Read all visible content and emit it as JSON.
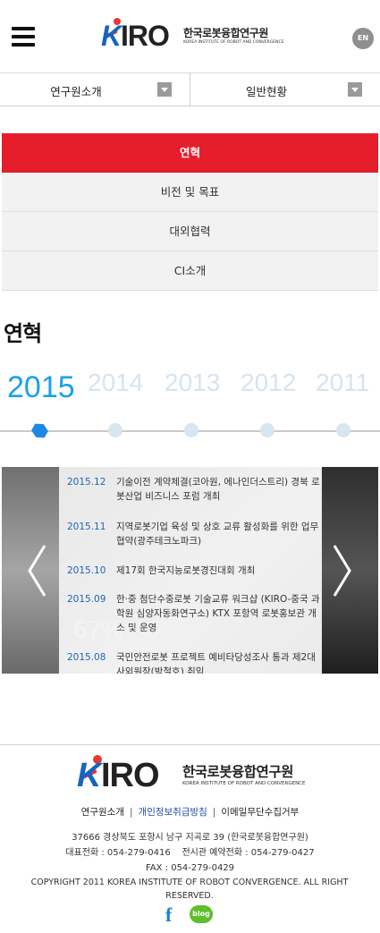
{
  "header": {
    "logo_mark": "KIRO",
    "logo_ko": "한국로봇융합연구원",
    "logo_en": "KOREA INSTITUTE OF ROBOT AND CONVERGENCE",
    "lang_button": "EN"
  },
  "nav_selects": [
    {
      "label": "연구원소개"
    },
    {
      "label": "일반현황"
    }
  ],
  "submenu": [
    {
      "label": "연혁",
      "active": true
    },
    {
      "label": "비전 및 목표",
      "active": false
    },
    {
      "label": "대외협력",
      "active": false
    },
    {
      "label": "CI소개",
      "active": false
    }
  ],
  "page_title": "연혁",
  "years": [
    "2015",
    "2014",
    "2013",
    "2012",
    "2011"
  ],
  "slider": {
    "bg_text": "67%",
    "events": [
      {
        "date": "2015.12",
        "text": "기술이전 계약체결(코아원, 에나인더스트리) 경북 로봇산업 비즈니스 포럼 개최"
      },
      {
        "date": "2015.11",
        "text": "지역로봇기업 육성 및 상호 교류 활성화를 위한 업무협약(광주테크노파크)"
      },
      {
        "date": "2015.10",
        "text": "제17회 한국지능로봇경진대회 개최"
      },
      {
        "date": "2015.09",
        "text": "한·중 첨단수중로봇 기술교류 워크샵 (KIRO-중국 과학원 심양자동화연구소) KTX 포항역 로봇홍보관 개소 및 운영"
      },
      {
        "date": "2015.08",
        "text": "국민안전로봇 프로젝트 예비타당성조사 통과 제2대 사외원장(박철호) 취임"
      }
    ]
  },
  "footer": {
    "logo_mark": "KIRO",
    "logo_ko": "한국로봇융합연구원",
    "logo_en": "KOREA INSTITUTE OF ROBOT AND CONVERGENCE",
    "links": [
      "연구원소개",
      "개인정보취급방침",
      "이메일무단수집거부"
    ],
    "address": "37666 경상북도 포항시 남구 지곡로 39 (한국로봇융합연구원)",
    "phones": "대표전화 : 054-279-0416    전시관 예약전화 : 054-279-0427",
    "fax": "FAX : 054-279-0429",
    "copyright": "COPYRIGHT 2011 KOREA INSTITUTE OF ROBOT CONVERGENCE. ALL RIGHT RESERVED.",
    "facebook": "f",
    "blog": "blog"
  },
  "colors": {
    "accent_red": "#e61e2b",
    "accent_blue": "#1aa1e6",
    "date_blue": "#1d64b7"
  },
  "icons": [
    "menu-icon",
    "dropdown-arrow-icon",
    "prev-arrow-icon",
    "next-arrow-icon",
    "facebook-icon",
    "blog-icon"
  ]
}
